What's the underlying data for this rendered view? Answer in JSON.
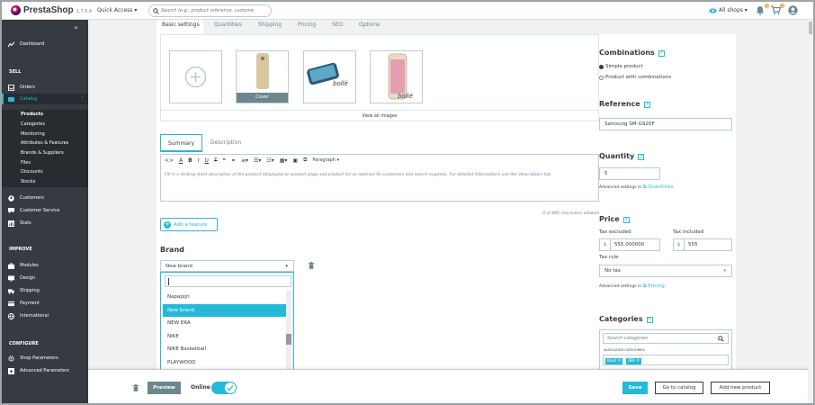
{
  "app": {
    "name": "PrestaShop",
    "version": "1.7.6.4"
  },
  "topbar": {
    "quick_access": "Quick Access ▾",
    "search_placeholder": "Search (e.g.: product reference, custome",
    "shop_selector": "All shops ▾",
    "notif_count": "1",
    "orders_count": "1"
  },
  "sidebar": {
    "collapse": "«",
    "dashboard": "Dashboard",
    "sell_header": "SELL",
    "orders": "Orders",
    "catalog": "Catalog",
    "catalog_subs": [
      "Products",
      "Categories",
      "Monitoring",
      "Attributes & Features",
      "Brands & Suppliers",
      "Files",
      "Discounts",
      "Stocks"
    ],
    "customers": "Customers",
    "customer_service": "Customer Service",
    "stats": "Stats",
    "improve_header": "IMPROVE",
    "modules": "Modules",
    "design": "Design",
    "shipping": "Shipping",
    "payment": "Payment",
    "international": "International",
    "configure_header": "CONFIGURE",
    "shop_parameters": "Shop Parameters",
    "advanced_parameters": "Advanced Parameters"
  },
  "tabs": [
    "Basic settings",
    "Quantities",
    "Shipping",
    "Pricing",
    "SEO",
    "Options"
  ],
  "images": {
    "cover_label": "Cover",
    "view_all": "View all images",
    "thumb_text": "bollé"
  },
  "description": {
    "tabs": [
      "Summary",
      "Description"
    ],
    "paragraph_select": "Paragraph ▾",
    "placeholder": "Fill in a striking short description of the product (displayed on product page and product list as abstract for customers and search engines). For detailed informations use the 'description' tab.",
    "counter": "0 of 800 characters allowed"
  },
  "feature_button": "Add a feature",
  "brand": {
    "title": "Brand",
    "selected": "New brand",
    "options": [
      "Napapijri",
      "New brand",
      "NEW ERA",
      "NIKE",
      "NIKE Basketball",
      "PLAYWOOD"
    ],
    "selected_index": 1
  },
  "combinations": {
    "title": "Combinations",
    "simple": "Simple product",
    "with": "Product with combinations"
  },
  "reference": {
    "title": "Reference",
    "value": "Samsung SM-G920F"
  },
  "quantity": {
    "title": "Quantity",
    "value": "5",
    "adv_text": "Advanced settings in",
    "adv_link": "Quantities"
  },
  "price": {
    "title": "Price",
    "tax_excl_label": "Tax excluded",
    "tax_excl_value": "555.000000",
    "tax_incl_label": "Tax included",
    "tax_incl_value": "555",
    "currency": "$",
    "tax_rule_label": "Tax rule",
    "tax_rule_value": "No tax",
    "adv_text": "Advanced settings in",
    "adv_link": "Pricing"
  },
  "categories": {
    "title": "Categories",
    "search_placeholder": "Search categories",
    "assoc_label": "ASSOCIATED CATEGORIES",
    "chips": [
      "Root ✕",
      "IBA ✕"
    ]
  },
  "footer": {
    "preview": "Preview",
    "online": "Online",
    "save": "Save",
    "go_catalog": "Go to catalog",
    "add_new": "Add new product"
  },
  "colors": {
    "accent": "#25b9d7",
    "sidebar": "#363a41",
    "brand_pink": "#df0067"
  }
}
